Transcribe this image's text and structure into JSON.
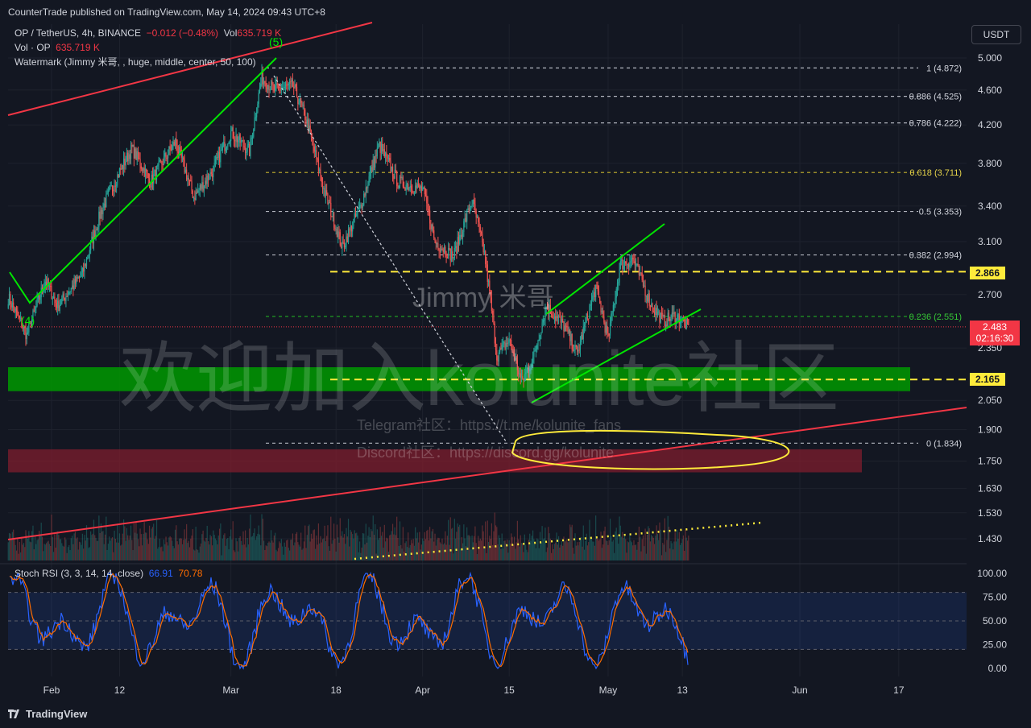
{
  "header": {
    "published": "CounterTrade published on TradingView.com, May 14, 2024 09:43 UTC+8",
    "symbol": "OP / TetherUS, 4h, BINANCE",
    "change": "−0.012 (−0.48%)",
    "vol_label": "Vol",
    "vol_value": "635.719 K",
    "vol_line_label": "Vol · OP",
    "vol_line_value": "635.719 K",
    "watermark_indicator": "Watermark (Jimmy 米哥, , huge, middle, center, 50, 100)",
    "currency": "USDT"
  },
  "watermark": {
    "main": "欢迎加入kolunite社区",
    "author": "Jimmy 米哥",
    "telegram": "Telegram社区：https://t.me/kolunite_fans",
    "discord": "Discord社区：https://discord.gg/kolunite"
  },
  "brand": "TradingView",
  "colors": {
    "background": "#131722",
    "up": "#26a69a",
    "down": "#ef5350",
    "trend_green": "#00e600",
    "trend_red": "#f23645",
    "yellow": "#ffeb3b",
    "stoch_k": "#2962ff",
    "stoch_d": "#ff6d00"
  },
  "chart_data": [
    {
      "type": "candlestick",
      "symbol": "OP / TetherUS",
      "interval": "4h",
      "y_axis_ticks": [
        "5.000",
        "4.600",
        "4.200",
        "3.800",
        "3.400",
        "3.100",
        "2.700",
        "2.350",
        "2.050",
        "1.900",
        "1.750",
        "1.630",
        "1.530",
        "1.430"
      ],
      "x_axis_ticks": [
        "Feb",
        "12",
        "Mar",
        "18",
        "Apr",
        "15",
        "May",
        "13",
        "Jun",
        "17"
      ],
      "price_path": [
        {
          "d": "Jan 25",
          "p": 2.68
        },
        {
          "d": "Jan 28",
          "p": 2.43
        },
        {
          "d": "Jan 31",
          "p": 2.8
        },
        {
          "d": "Feb 2",
          "p": 2.62
        },
        {
          "d": "Feb 6",
          "p": 2.85
        },
        {
          "d": "Feb 9",
          "p": 3.35
        },
        {
          "d": "Feb 12",
          "p": 3.72
        },
        {
          "d": "Feb 14",
          "p": 3.95
        },
        {
          "d": "Feb 17",
          "p": 3.62
        },
        {
          "d": "Feb 21",
          "p": 4.02
        },
        {
          "d": "Feb 24",
          "p": 3.48
        },
        {
          "d": "Feb 27",
          "p": 3.72
        },
        {
          "d": "Mar 1",
          "p": 4.12
        },
        {
          "d": "Mar 4",
          "p": 3.92
        },
        {
          "d": "Mar 6",
          "p": 4.75
        },
        {
          "d": "Mar 8",
          "p": 4.6
        },
        {
          "d": "Mar 11",
          "p": 4.65
        },
        {
          "d": "Mar 13",
          "p": 4.3
        },
        {
          "d": "Mar 16",
          "p": 3.55
        },
        {
          "d": "Mar 19",
          "p": 3.05
        },
        {
          "d": "Mar 22",
          "p": 3.4
        },
        {
          "d": "Mar 25",
          "p": 3.98
        },
        {
          "d": "Mar 28",
          "p": 3.62
        },
        {
          "d": "Apr 1",
          "p": 3.55
        },
        {
          "d": "Apr 3",
          "p": 3.1
        },
        {
          "d": "Apr 6",
          "p": 2.98
        },
        {
          "d": "Apr 9",
          "p": 3.45
        },
        {
          "d": "Apr 11",
          "p": 3.0
        },
        {
          "d": "Apr 13",
          "p": 2.3
        },
        {
          "d": "Apr 15",
          "p": 2.4
        },
        {
          "d": "Apr 17",
          "p": 2.15
        },
        {
          "d": "Apr 19",
          "p": 2.3
        },
        {
          "d": "Apr 21",
          "p": 2.62
        },
        {
          "d": "Apr 24",
          "p": 2.48
        },
        {
          "d": "Apr 26",
          "p": 2.31
        },
        {
          "d": "Apr 29",
          "p": 2.75
        },
        {
          "d": "May 1",
          "p": 2.4
        },
        {
          "d": "May 3",
          "p": 2.92
        },
        {
          "d": "May 5",
          "p": 2.96
        },
        {
          "d": "May 8",
          "p": 2.62
        },
        {
          "d": "May 10",
          "p": 2.52
        },
        {
          "d": "May 12",
          "p": 2.56
        },
        {
          "d": "May 14",
          "p": 2.483
        }
      ],
      "fibonacci": [
        {
          "level": "1",
          "price": 4.872,
          "label": "1 (4.872)"
        },
        {
          "level": "0.886",
          "price": 4.525,
          "label": "0.886 (4.525)"
        },
        {
          "level": "0.786",
          "price": 4.222,
          "label": "0.786 (4.222)"
        },
        {
          "level": "0.618",
          "price": 3.711,
          "label": "0.618 (3.711)"
        },
        {
          "level": "0.5",
          "price": 3.353,
          "label": "0.5 (3.353)"
        },
        {
          "level": "0.382",
          "price": 2.994,
          "label": "0.382 (2.994)"
        },
        {
          "level": "0.236",
          "price": 2.551,
          "label": "0.236 (2.551)"
        },
        {
          "level": "0",
          "price": 1.834,
          "label": "0 (1.834)"
        }
      ],
      "horizontal_levels": [
        {
          "price": 2.866,
          "label": "2.866",
          "color": "#ffeb3b"
        },
        {
          "price": 2.165,
          "label": "2.165",
          "color": "#ffeb3b"
        }
      ],
      "last_price": {
        "value": "2.483",
        "countdown": "02:16:30"
      },
      "wave_labels": [
        {
          "label": "(5)",
          "d": "Mar 6"
        },
        {
          "label": "(4)",
          "d": "Jan 28"
        }
      ]
    },
    {
      "type": "line",
      "title": "Stoch RSI (3, 3, 14, 14, close)",
      "k_value": "66.91",
      "d_value": "70.78",
      "y_axis_ticks": [
        "100.00",
        "75.00",
        "50.00",
        "25.00",
        "0.00"
      ],
      "band": [
        20,
        80
      ]
    }
  ]
}
